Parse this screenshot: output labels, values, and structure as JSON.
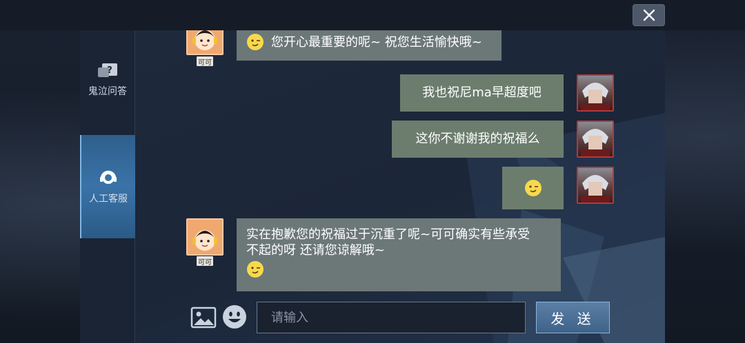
{
  "window": {
    "close_icon": "close-icon"
  },
  "sidebar": {
    "items": [
      {
        "label": "鬼泣问答",
        "icon": "question-bubble-icon",
        "active": false
      },
      {
        "label": "人工客服",
        "icon": "headset-icon",
        "active": true
      }
    ]
  },
  "messages": [
    {
      "from": "agent",
      "name": "可可",
      "text": "您开心最重要的呢~ 祝您生活愉快哦~",
      "emoji": "wink-emoji-icon"
    },
    {
      "from": "me",
      "text": "我也祝尼ma早超度吧"
    },
    {
      "from": "me",
      "text": "这你不谢谢我的祝福么"
    },
    {
      "from": "me",
      "text": "",
      "emoji": "wink-emoji-icon"
    },
    {
      "from": "agent",
      "name": "可可",
      "line1": "实在抱歉您的祝福过于沉重了呢~可可确实有些承受",
      "line2": "不起的呀 还请您谅解哦~",
      "emoji": "wink-emoji-icon"
    }
  ],
  "input": {
    "placeholder": "请输入",
    "value": "",
    "send_label": "发 送",
    "image_icon": "image-icon",
    "emoji_icon": "smiley-icon"
  },
  "colors": {
    "agent_bubble": "#6c7778",
    "my_bubble": "#6c7d6d",
    "active_tab": "#3a73a8"
  }
}
